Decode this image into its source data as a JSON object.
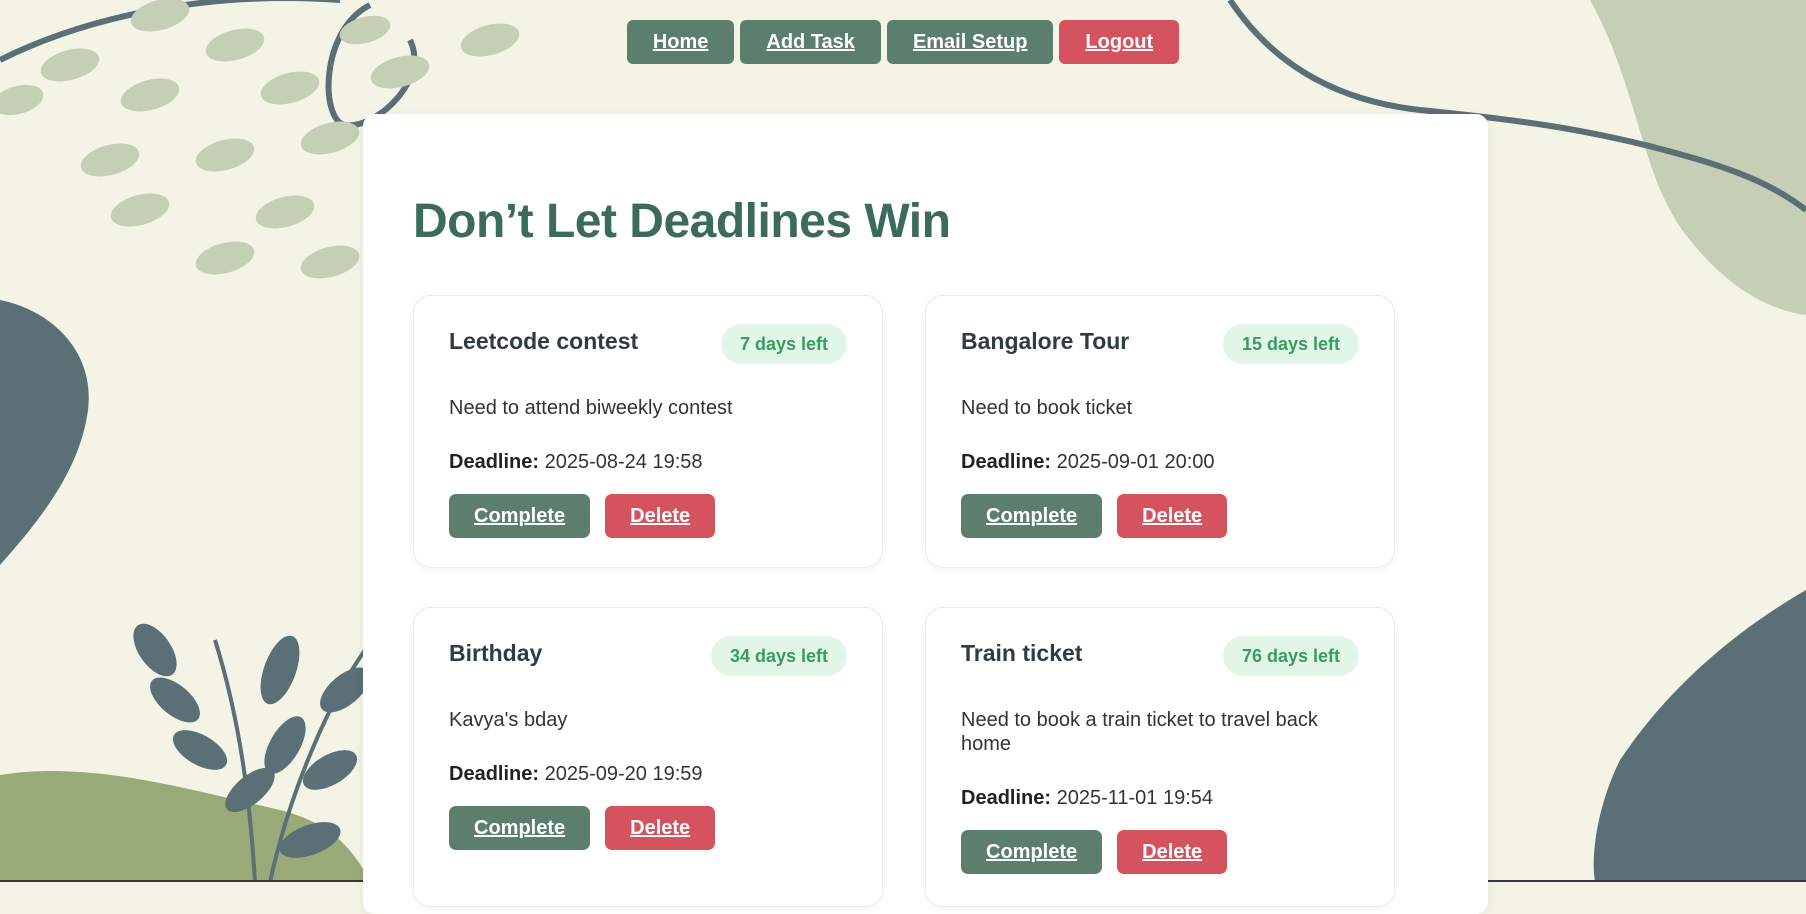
{
  "nav": {
    "home": "Home",
    "add_task": "Add Task",
    "email_setup": "Email Setup",
    "logout": "Logout"
  },
  "page": {
    "title": "Don’t Let Deadlines Win"
  },
  "tasks": [
    {
      "title": "Leetcode contest",
      "badge": "7 days left",
      "description": "Need to attend biweekly contest",
      "deadline_label": "Deadline:",
      "deadline": "2025-08-24 19:58",
      "complete_label": "Complete",
      "delete_label": "Delete"
    },
    {
      "title": "Bangalore Tour",
      "badge": "15 days left",
      "description": "Need to book ticket",
      "deadline_label": "Deadline:",
      "deadline": "2025-09-01 20:00",
      "complete_label": "Complete",
      "delete_label": "Delete"
    },
    {
      "title": "Birthday",
      "badge": "34 days left",
      "description": "Kavya's bday",
      "deadline_label": "Deadline:",
      "deadline": "2025-09-20 19:59",
      "complete_label": "Complete",
      "delete_label": "Delete"
    },
    {
      "title": "Train ticket",
      "badge": "76 days left",
      "description": "Need to book a train ticket to travel back home",
      "deadline_label": "Deadline:",
      "deadline": "2025-11-01 19:54",
      "complete_label": "Complete",
      "delete_label": "Delete"
    }
  ],
  "colors": {
    "background": "#f3f4e6",
    "primary_green": "#5b7f6c",
    "danger_red": "#d4535f",
    "title_green": "#3c6b5e",
    "badge_bg": "#e2f6e8",
    "badge_text": "#3a9a63",
    "decor_sage": "#c4cfb5",
    "decor_slate": "#5a6f76",
    "decor_olive": "#98aa78"
  }
}
